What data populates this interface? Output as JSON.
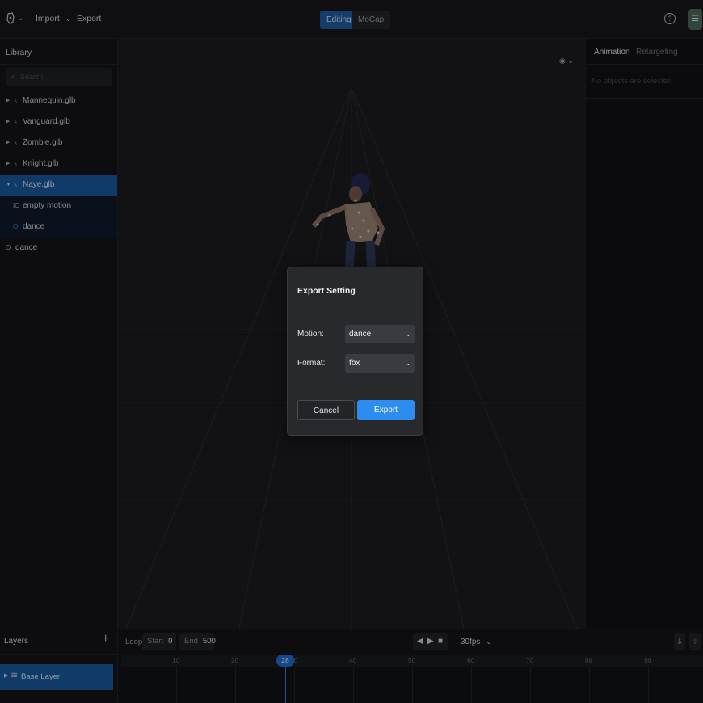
{
  "topbar": {
    "logo_icon": "hand-logo-icon",
    "menus": {
      "import": "Import",
      "export": "Export"
    },
    "modes": [
      {
        "label": "Editing",
        "active": true
      },
      {
        "label": "MoCap",
        "active": false
      }
    ],
    "help_icon": "question-circle-icon",
    "avatar_icon": "user-badge-icon"
  },
  "library": {
    "title": "Library",
    "search_placeholder": "Search",
    "items": [
      {
        "label": "Mannequin.glb"
      },
      {
        "label": "Vanguard.glb"
      },
      {
        "label": "Zombie.glb"
      },
      {
        "label": "Knight.glb"
      },
      {
        "label": "Naye.glb"
      },
      {
        "label": "empty motion"
      },
      {
        "label": "dance"
      },
      {
        "label": "dance"
      }
    ]
  },
  "right_panel": {
    "tabs": {
      "animation": "Animation",
      "retargeting": "Retargeting"
    },
    "empty_message": "No objects are selected"
  },
  "layers": {
    "title": "Layers",
    "add_label": "+",
    "base_layer": "Base Layer"
  },
  "timeline": {
    "loop_label": "Loop",
    "start_label": "Start",
    "start_value": "0",
    "end_label": "End",
    "end_value": "500",
    "fps": "30fps",
    "current_frame": "28",
    "ticks": [
      "10",
      "20",
      "30",
      "40",
      "50",
      "60",
      "70",
      "80",
      "90"
    ]
  },
  "export_dialog": {
    "title": "Export Setting",
    "motion_label": "Motion:",
    "motion_value": "dance",
    "format_label": "Format:",
    "format_value": "fbx",
    "cancel_label": "Cancel",
    "export_label": "Export",
    "accent": "#2d8cf0"
  }
}
